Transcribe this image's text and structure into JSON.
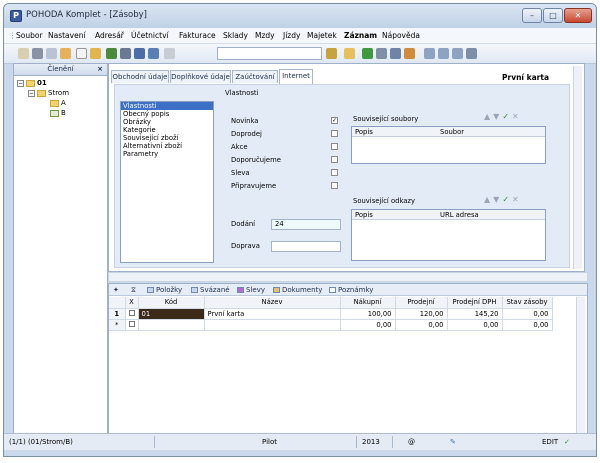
{
  "window": {
    "title": "POHODA Komplet - [Zásoby]",
    "app_icon": "pohoda-app-icon"
  },
  "menu": [
    "Soubor",
    "Nastavení",
    "Adresář",
    "Účetnictví",
    "Fakturace",
    "Sklady",
    "Mzdy",
    "Jízdy",
    "Majetek",
    "Záznam",
    "Nápověda"
  ],
  "left_panel": {
    "title": "Členění",
    "tree": {
      "root": "01",
      "child": "Strom",
      "leaves": [
        "A",
        "B"
      ]
    }
  },
  "tabs": [
    "Obchodní údaje",
    "Doplňkové údaje",
    "Zaúčtování",
    "Internet"
  ],
  "header_title": "První karta",
  "panel": {
    "title": "Vlastnosti",
    "properties": [
      "Vlastnosti",
      "Obecný popis",
      "Obrázky",
      "Kategorie",
      "Související zboží",
      "Alternativní zboží",
      "Parametry"
    ],
    "checks": [
      {
        "label": "Novinka",
        "checked": true
      },
      {
        "label": "Doprodej",
        "checked": false
      },
      {
        "label": "Akce",
        "checked": false
      },
      {
        "label": "Doporučujeme",
        "checked": false
      },
      {
        "label": "Sleva",
        "checked": false
      },
      {
        "label": "Připravujeme",
        "checked": false
      }
    ],
    "dodani_label": "Dodání",
    "dodani_value": "24",
    "doprava_label": "Doprava",
    "doprava_value": "",
    "related_files": {
      "title": "Související soubory",
      "col1": "Popis",
      "col2": "Soubor"
    },
    "related_links": {
      "title": "Související odkazy",
      "col1": "Popis",
      "col2": "URL adresa"
    }
  },
  "bottom_tabs": [
    "Položky",
    "Svázané",
    "Slevy",
    "Dokumenty",
    "Poznámky"
  ],
  "grid": {
    "headers": [
      "X",
      "Kód",
      "Název",
      "Nákupní",
      "Prodejní",
      "Prodejní DPH",
      "Stav zásoby"
    ],
    "rows": [
      {
        "num": "1",
        "kod": "01",
        "nazev": "První karta",
        "nakupni": "100,00",
        "prodejni": "120,00",
        "prodejni_dph": "145,20",
        "stav": "0,00"
      },
      {
        "num": "*",
        "kod": "",
        "nazev": "",
        "nakupni": "0,00",
        "prodejni": "0,00",
        "prodejni_dph": "0,00",
        "stav": "0,00"
      }
    ]
  },
  "status": {
    "record": "(1/1) (01/Strom/B)",
    "mode": "Pilot",
    "year": "2013",
    "at": "@",
    "edit": "EDIT"
  }
}
